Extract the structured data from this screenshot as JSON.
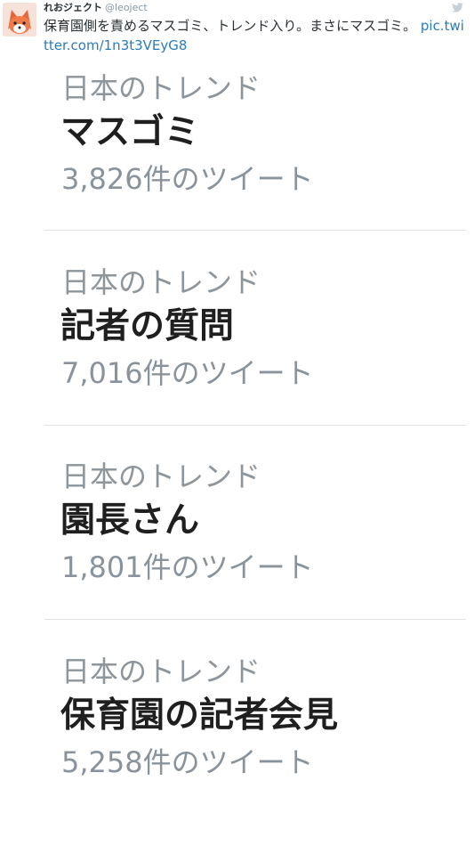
{
  "tweet": {
    "display_name": "れおジェクト",
    "handle": "@leoject",
    "text": "保育園側を責めるマスゴミ、トレンド入り。まさにマスゴミ。 ",
    "link": "pic.twitter.com/1n3t3VEyG8",
    "avatar_icon": "fox-avatar-icon",
    "bird_icon": "twitter-bird-icon"
  },
  "trends": [
    {
      "context": "日本のトレンド",
      "name": "マスゴミ",
      "count": "3,826件のツイート"
    },
    {
      "context": "日本のトレンド",
      "name": "記者の質問",
      "count": "7,016件のツイート"
    },
    {
      "context": "日本のトレンド",
      "name": "園長さん",
      "count": "1,801件のツイート"
    },
    {
      "context": "日本のトレンド",
      "name": "保育園の記者会見",
      "count": "5,258件のツイート"
    }
  ],
  "colors": {
    "link": "#2b7bb9",
    "context_text": "#8e959b",
    "trend_name": "#1f1f1f",
    "divider": "#e1e4e7"
  }
}
